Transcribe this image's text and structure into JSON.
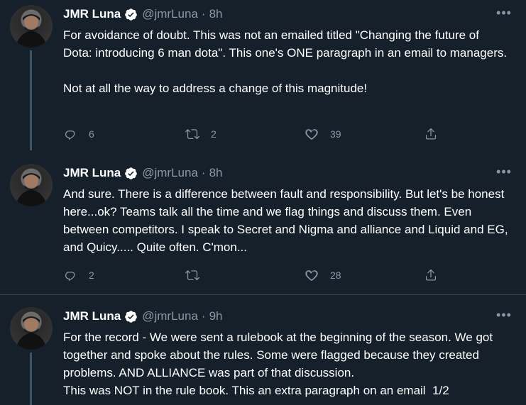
{
  "tweets": [
    {
      "name": "JMR Luna",
      "handle": "@jmrLuna",
      "dot": "·",
      "time": "8h",
      "text": "For avoidance of doubt. This was not an emailed titled \"Changing the future of Dota: introducing 6 man dota\". This one's ONE paragraph in an email to managers.\n\nNot at all the way to address a change of this magnitude!",
      "replies": "6",
      "retweets": "2",
      "likes": "39"
    },
    {
      "name": "JMR Luna",
      "handle": "@jmrLuna",
      "dot": "·",
      "time": "8h",
      "text": "And sure. There is a difference between fault and responsibility. But let's be honest here...ok? Teams talk all the time and we flag things and discuss them. Even between competitors. I speak to Secret and Nigma and alliance and Liquid and EG, and Quicy..... Quite often. C'mon...",
      "replies": "2",
      "retweets": "",
      "likes": "28"
    },
    {
      "name": "JMR Luna",
      "handle": "@jmrLuna",
      "dot": "·",
      "time": "9h",
      "text": "For the record - We were sent a rulebook at the beginning of the season. We got together and spoke about the rules. Some were flagged because they created problems. AND ALLIANCE was part of that discussion.\nThis was NOT in the rule book. This an extra paragraph on an email  1/2"
    }
  ],
  "icons": {
    "verified": "verified-badge-icon",
    "more": "more-options-icon",
    "reply": "reply-icon",
    "retweet": "retweet-icon",
    "like": "like-icon",
    "share": "share-icon"
  },
  "colors": {
    "background": "#15202b",
    "muted": "#8899a6",
    "verified": "#ffffff",
    "divider": "#38444d"
  }
}
